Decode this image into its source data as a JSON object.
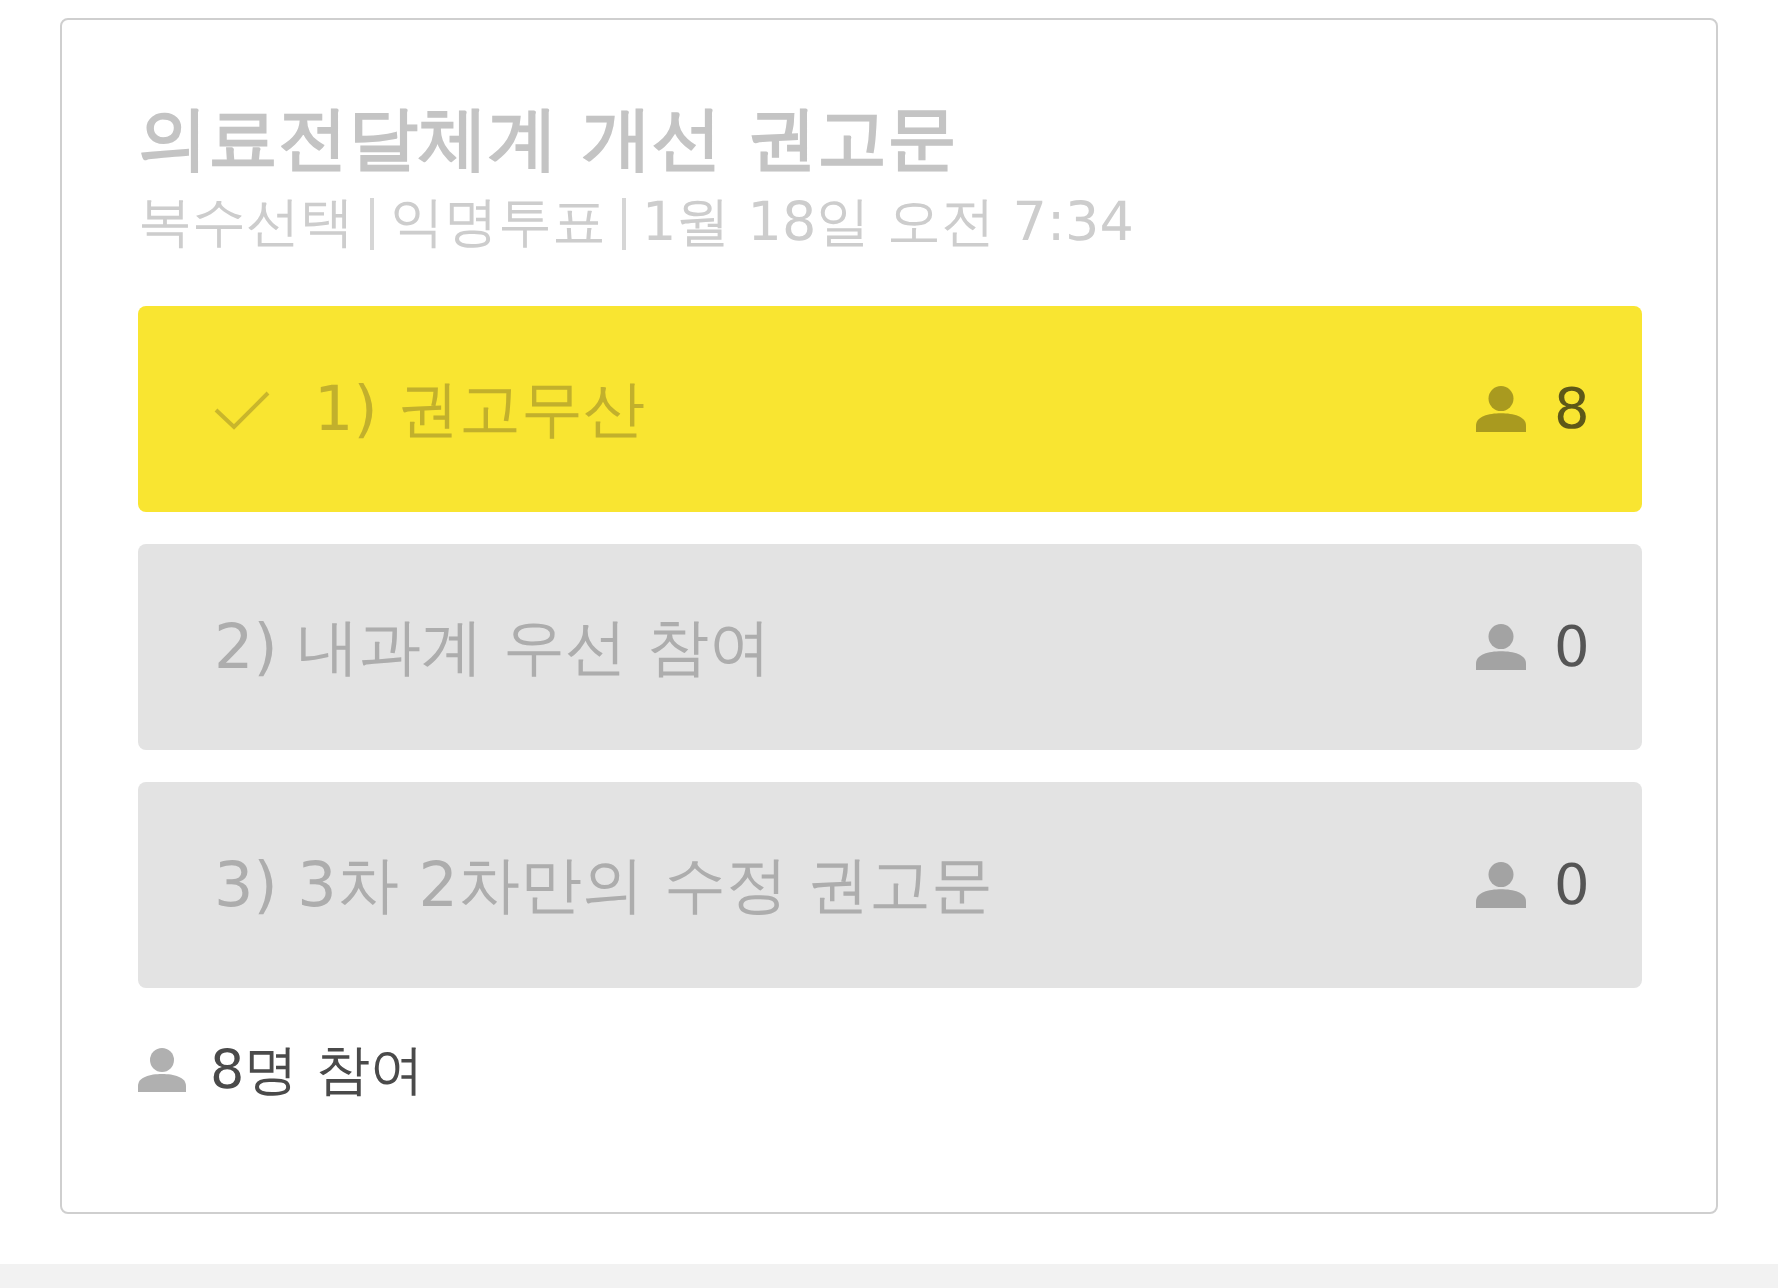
{
  "poll": {
    "title": "의료전달체계 개선 권고문",
    "meta": [
      "복수선택",
      "익명투표",
      "1월 18일 오전 7:34"
    ],
    "options": [
      {
        "label": "1) 권고무산",
        "count": "8",
        "selected": true
      },
      {
        "label": "2) 내과계 우선 참여",
        "count": "0",
        "selected": false
      },
      {
        "label": "3) 3차 2차만의 수정 권고문",
        "count": "0",
        "selected": false
      }
    ],
    "participants": "8명 참여"
  }
}
